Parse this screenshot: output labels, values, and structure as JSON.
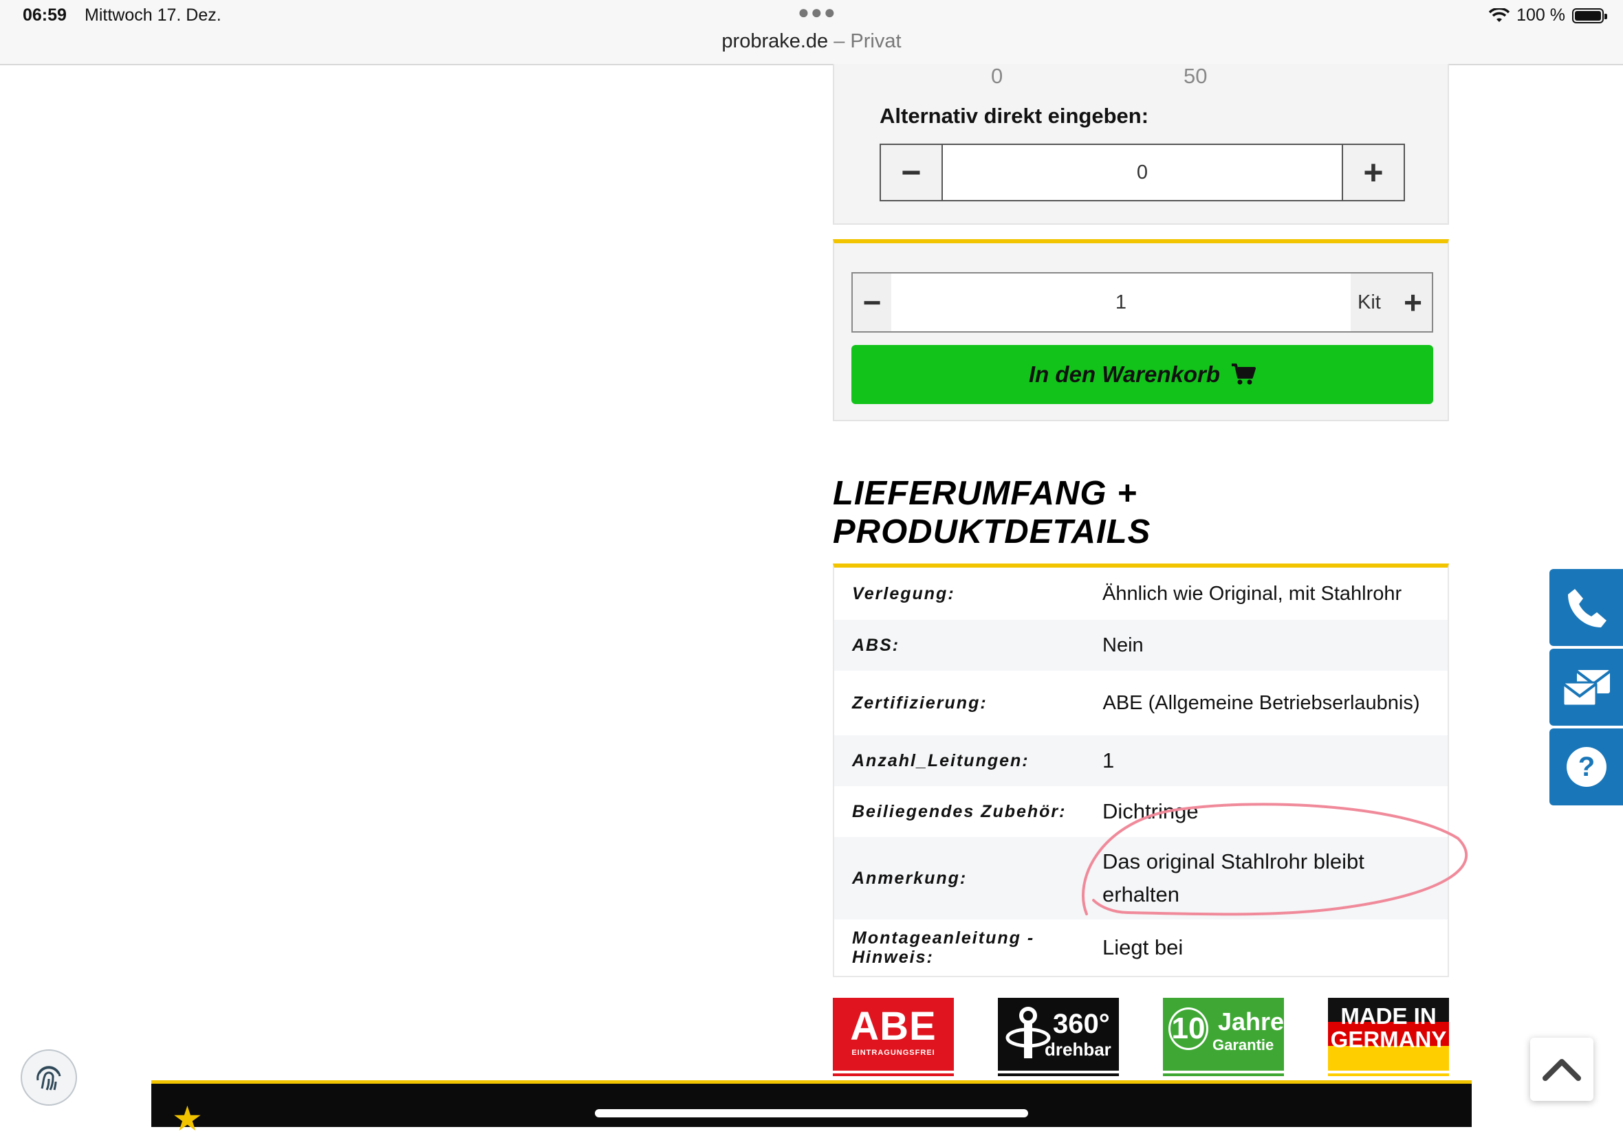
{
  "status_bar": {
    "time": "06:59",
    "date": "Mittwoch 17. Dez.",
    "battery": "100 %"
  },
  "address_bar": {
    "domain": "probrake.de",
    "mode": "– Privat"
  },
  "slider": {
    "tick_min": "0",
    "tick_max": "50",
    "alt_label": "Alternativ direkt eingeben:",
    "value": "0",
    "minus": "−",
    "plus": "+"
  },
  "cart": {
    "quantity": "1",
    "unit": "Kit",
    "minus": "−",
    "plus": "+",
    "button_label": "In den Warenkorb"
  },
  "section": {
    "title_line1": "LIEFERUMFANG +",
    "title_line2": "PRODUKTDETAILS"
  },
  "details": [
    {
      "key": "Verlegung:",
      "value": "Ähnlich wie Original, mit Stahlrohr"
    },
    {
      "key": "ABS:",
      "value": "Nein"
    },
    {
      "key": "Zertifizierung:",
      "value": "ABE (Allgemeine Betriebserlaubnis)"
    },
    {
      "key": "Anzahl_Leitungen:",
      "value": "1"
    },
    {
      "key": "Beiliegendes Zubehör:",
      "value": "Dichtringe"
    },
    {
      "key": "Anmerkung:",
      "value": "Das original Stahlrohr bleibt erhalten"
    },
    {
      "key": "Montageanleitung - Hinweis:",
      "value": "Liegt bei"
    }
  ],
  "badges": {
    "abe_title": "ABE",
    "abe_sub": "EINTRAGUNGSFREI",
    "rot_title": "360°",
    "rot_sub": "drehbar",
    "gar_num": "10",
    "gar_title": "Jahre",
    "gar_sub": "Garantie",
    "made_line1": "MADE IN",
    "made_line2": "GERMANY"
  },
  "colors": {
    "accent_yellow": "#f2c400",
    "cart_green": "#12c41a",
    "contact_blue": "#1976b8",
    "annotation_pink": "#f08a9a"
  },
  "icons": {
    "cart": "shopping-cart-icon",
    "phone": "phone-icon",
    "mail": "envelope-icon",
    "help": "question-icon",
    "top": "chevron-up-icon",
    "fingerprint": "fingerprint-icon",
    "star": "star-icon"
  }
}
